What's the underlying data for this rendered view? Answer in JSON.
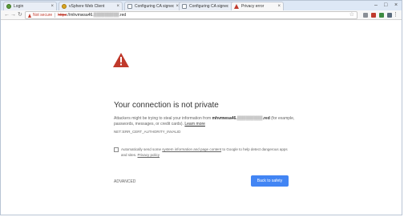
{
  "tabs": [
    {
      "label": "Login",
      "favicon": "globe-icon",
      "active": false
    },
    {
      "label": "vSphere Web Client",
      "favicon": "vsphere-icon",
      "active": false
    },
    {
      "label": "Configuring CA signed c",
      "favicon": "document-icon",
      "active": false
    },
    {
      "label": "Configuring CA signed c",
      "favicon": "document-icon",
      "active": false
    },
    {
      "label": "Privacy error",
      "favicon": "warning-icon",
      "active": true
    }
  ],
  "toolbar": {
    "not_secure": "Not secure",
    "url_scheme": "https",
    "url_rest": "://mhvmwsa46.▒▒▒▒▒▒▒▒▒.red"
  },
  "error": {
    "title": "Your connection is not private",
    "text_before": "Attackers might be trying to steal your information from ",
    "host": "mhvmwsa46.▒▒▒▒▒▒▒▒▒.red",
    "text_after": " (for example, passwords, messages, or credit cards). ",
    "learn_more": "Learn more",
    "code": "NET::ERR_CERT_AUTHORITY_INVALID"
  },
  "report": {
    "before": "Automatically send some ",
    "link": "system information and page content",
    "after": " to Google to help detect dangerous apps and sites. ",
    "privacy": "Privacy policy"
  },
  "actions": {
    "advanced": "ADVANCED",
    "back_to_safety": "Back to safety"
  },
  "colors": {
    "warning_red": "#c0392b",
    "button_blue": "#4285f4"
  }
}
